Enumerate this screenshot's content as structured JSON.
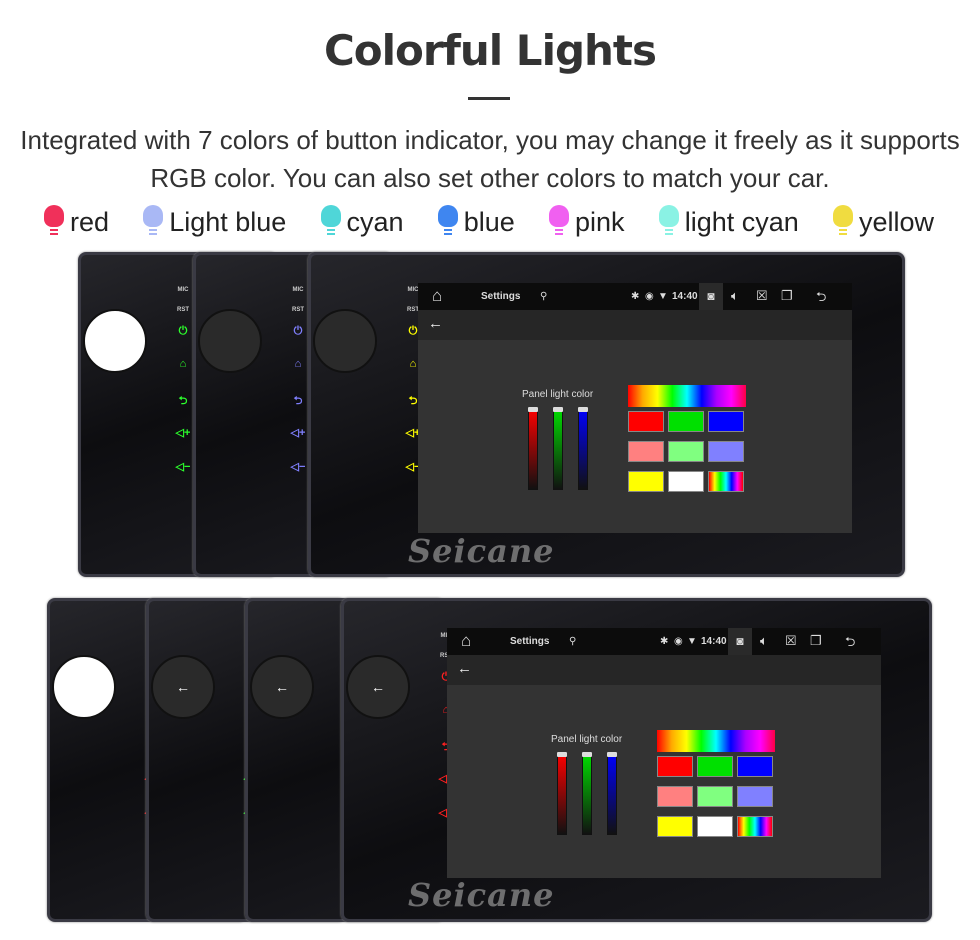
{
  "header": {
    "title": "Colorful Lights",
    "description": "Integrated with 7 colors of button indicator, you may change it freely as it supports RGB color. You can also set other colors to match your car."
  },
  "legend": [
    {
      "label": "red",
      "color": "#f0305a"
    },
    {
      "label": "Light blue",
      "color": "#a9b8f5"
    },
    {
      "label": "cyan",
      "color": "#4fd6d8"
    },
    {
      "label": "blue",
      "color": "#3f86f0"
    },
    {
      "label": "pink",
      "color": "#f060f0"
    },
    {
      "label": "light cyan",
      "color": "#8af2e4"
    },
    {
      "label": "yellow",
      "color": "#f0dc40"
    }
  ],
  "side_panel": {
    "mic": "MIC",
    "rst": "RST",
    "icons": [
      "power-icon",
      "home-icon",
      "back-icon",
      "volume-up-icon",
      "volume-down-icon"
    ]
  },
  "screen": {
    "app_title": "Settings",
    "time": "14:40",
    "panel_label": "Panel light color",
    "back_arrow": "←",
    "sliders": [
      "#ff0000",
      "#00e000",
      "#0000ff"
    ],
    "swatches": [
      "#ff0000",
      "#00e000",
      "#0000ff",
      "#ff8080",
      "#80ff80",
      "#8080ff",
      "#ffff00",
      "#ffffff",
      "rainbow"
    ]
  },
  "watermark": "Seicane",
  "top_row_colors": [
    "#2cff2c",
    "#8080ff",
    "#ffff00"
  ],
  "bottom_row_colors": [
    "#ff2020",
    "#2cff2c",
    "#2020ff",
    "#ff2020"
  ]
}
